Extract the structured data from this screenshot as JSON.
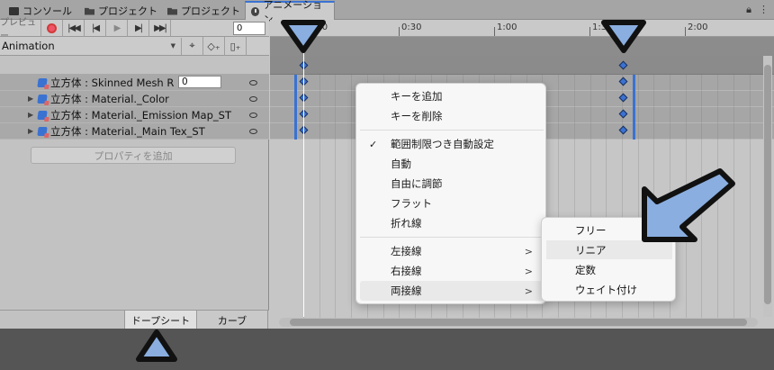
{
  "tabs": [
    {
      "label": "コンソール",
      "icon": "console-icon"
    },
    {
      "label": "プロジェクト",
      "icon": "folder-icon"
    },
    {
      "label": "プロジェクト",
      "icon": "folder-icon"
    },
    {
      "label": "アニメーション",
      "icon": "clock-icon",
      "active": true
    }
  ],
  "toolbar": {
    "preview_label": "プレビュー",
    "frame_value": "0",
    "clip_name": "Animation"
  },
  "properties": [
    {
      "label": "立方体 : Skinned Mesh R",
      "value": "0",
      "expandable": false
    },
    {
      "label": "立方体 : Material._Color",
      "expandable": true
    },
    {
      "label": "立方体 : Material._Emission Map_ST",
      "expandable": true
    },
    {
      "label": "立方体 : Material._Main Tex_ST",
      "expandable": true
    }
  ],
  "add_property_label": "プロパティを追加",
  "bottom_tabs": {
    "dopesheet": "ドープシート",
    "curves": "カーブ"
  },
  "ruler": {
    "labels": [
      ":00",
      "0:30",
      "1:00",
      "1:30",
      "2:00"
    ]
  },
  "context_menu": {
    "items": [
      {
        "label": "キーを追加"
      },
      {
        "label": "キーを削除"
      },
      {
        "label": "範囲制限つき自動設定",
        "checked": true
      },
      {
        "label": "自動"
      },
      {
        "label": "自由に調節"
      },
      {
        "label": "フラット"
      },
      {
        "label": "折れ線"
      },
      {
        "label": "左接線",
        "submenu": true
      },
      {
        "label": "右接線",
        "submenu": true
      },
      {
        "label": "両接線",
        "submenu": true,
        "highlighted": true
      }
    ]
  },
  "submenu": {
    "items": [
      {
        "label": "フリー"
      },
      {
        "label": "リニア",
        "highlighted": true
      },
      {
        "label": "定数"
      },
      {
        "label": "ウェイト付け"
      }
    ]
  },
  "colors": {
    "accent": "#3a72d2",
    "annotation_fill": "#8aaee0",
    "annotation_stroke": "#111111"
  }
}
